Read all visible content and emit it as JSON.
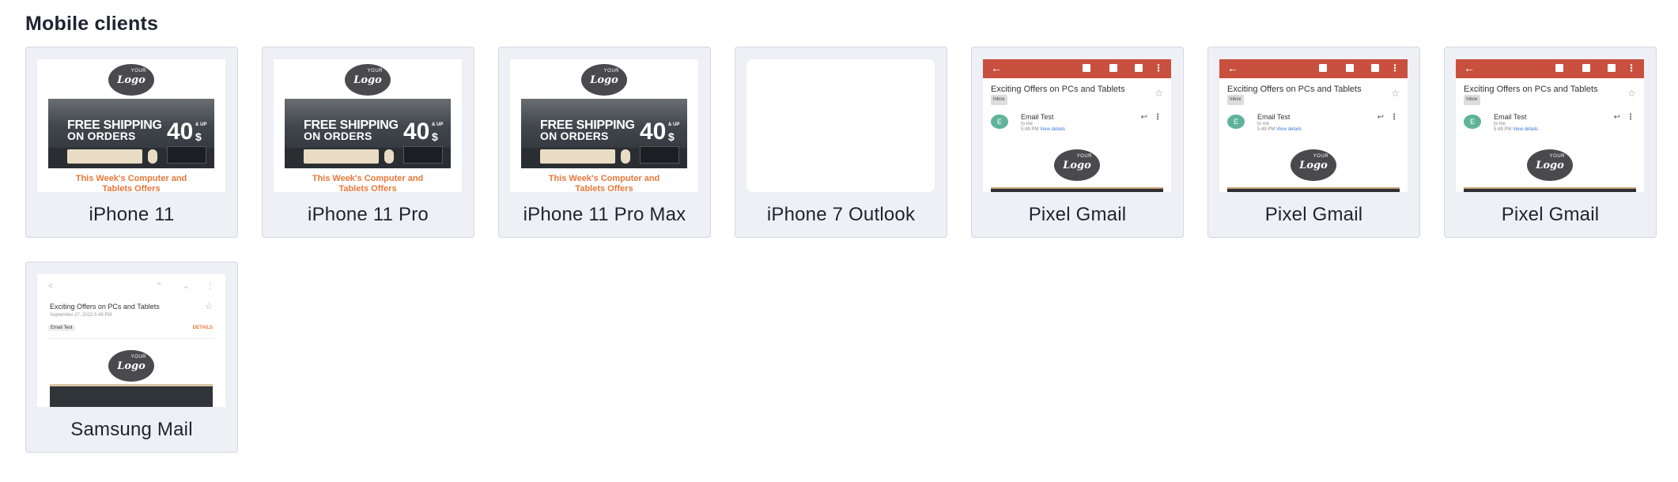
{
  "section": {
    "title": "Mobile clients"
  },
  "preview_text": {
    "logo_your": "YOUR",
    "logo_word": "Logo",
    "free_shipping": "FREE SHIPPING",
    "on_orders": "ON ORDERS",
    "amount": "40",
    "up": "& UP",
    "currency": "$",
    "offer_line1": "This Week's Computer and",
    "offer_line2": "Tablets Offers",
    "gmail_subject": "Exciting Offers on PCs and Tablets",
    "gmail_inbox": "Inbox",
    "gmail_from": "Email Test",
    "gmail_to": "to me",
    "gmail_time": "5:49 PM",
    "gmail_view": "View details",
    "avatar_letter": "E",
    "samsung_subject": "Exciting Offers on PCs and   Tablets",
    "samsung_date": "September 27, 2022  5:49 PM",
    "samsung_tag": "Email Test",
    "samsung_details": "DETAILS"
  },
  "clients": [
    {
      "label": "iPhone 11",
      "preview": "iphone"
    },
    {
      "label": "iPhone 11 Pro",
      "preview": "iphone"
    },
    {
      "label": "iPhone 11 Pro Max",
      "preview": "iphone"
    },
    {
      "label": "iPhone 7 Outlook",
      "preview": "blank"
    },
    {
      "label": "Pixel Gmail",
      "preview": "gmail"
    },
    {
      "label": "Pixel Gmail",
      "preview": "gmail"
    },
    {
      "label": "Pixel Gmail",
      "preview": "gmail"
    },
    {
      "label": "Samsung Mail",
      "preview": "samsung"
    }
  ],
  "colors": {
    "card_bg": "#eef0f6",
    "gmail_bar": "#c9503f",
    "offer_orange": "#e8773a",
    "avatar_green": "#5fb39a"
  }
}
